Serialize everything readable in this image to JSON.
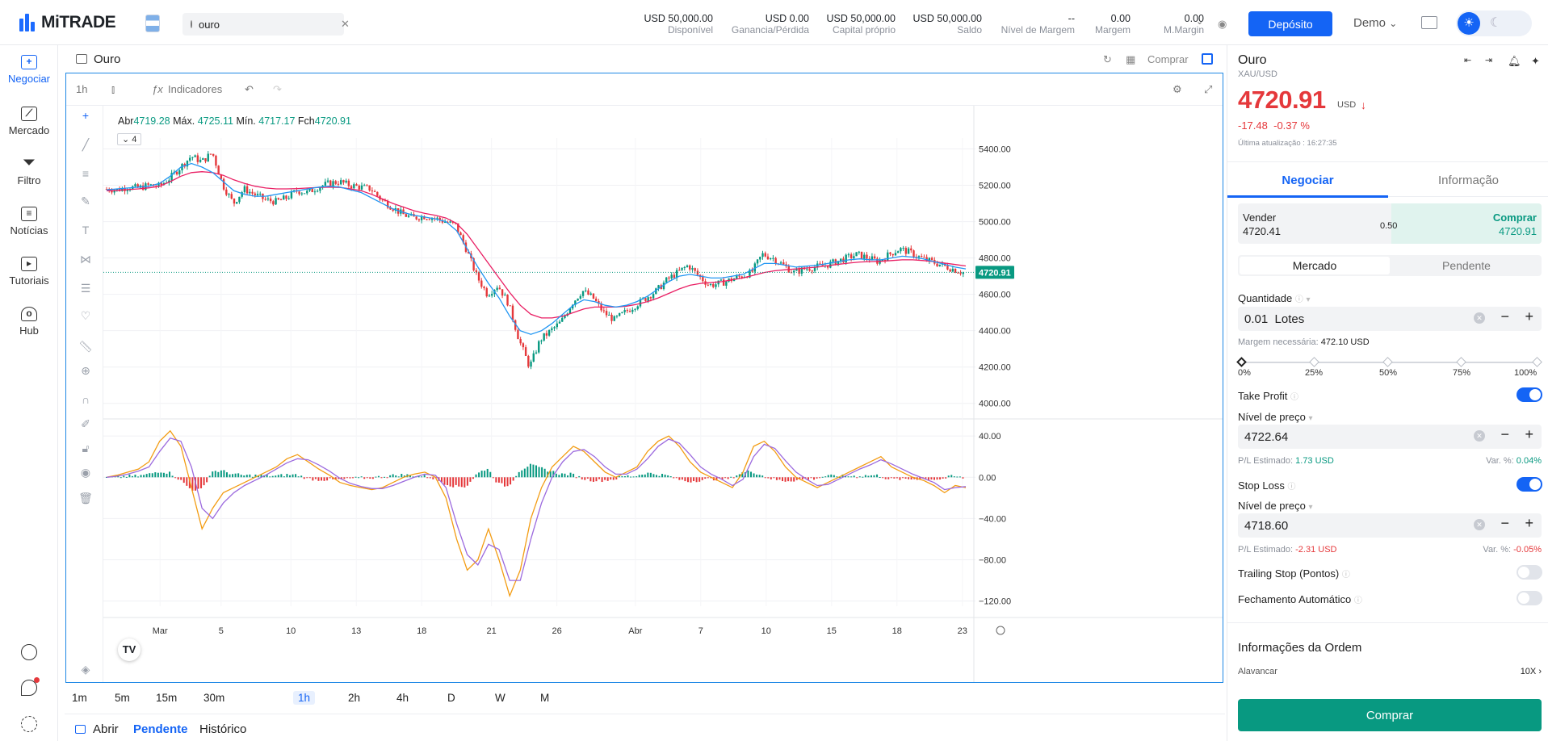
{
  "app": {
    "logo": "MiTRADE",
    "search_value": "ouro"
  },
  "account": [
    {
      "value": "USD 50,000.00",
      "label": "Disponível"
    },
    {
      "value": "USD 0.00",
      "label": "Ganancia/Pérdida"
    },
    {
      "value": "USD 50,000.00",
      "label": "Capital próprio"
    },
    {
      "value": "USD 50,000.00",
      "label": "Saldo"
    },
    {
      "value": "--",
      "label": "Nível de Margem"
    },
    {
      "value": "0.00",
      "label": "Margem"
    },
    {
      "value": "0.00",
      "label": "M.Margin"
    }
  ],
  "header": {
    "deposit": "Depósito",
    "mode": "Demo"
  },
  "sidebar": {
    "items": [
      {
        "label": "Negociar",
        "icon": "plus-square-icon"
      },
      {
        "label": "Mercado",
        "icon": "chart-line-icon"
      },
      {
        "label": "Filtro",
        "icon": "filter-icon"
      },
      {
        "label": "Notícias",
        "icon": "news-icon"
      },
      {
        "label": "Tutoriais",
        "icon": "play-icon"
      },
      {
        "label": "Hub",
        "icon": "user-icon"
      }
    ]
  },
  "chart_panel": {
    "title": "Ouro",
    "buy_link": "Comprar",
    "interval": "1h",
    "indicators": "Indicadores",
    "ohlc": {
      "open_label": "Abr",
      "open": "4719.28",
      "high_label": "Máx.",
      "high": "4725.11",
      "low_label": "Mín.",
      "low": "4717.17",
      "close_label": "Fch",
      "close": "4720.91"
    },
    "collapse_count": "4",
    "timeframes": [
      "1m",
      "5m",
      "15m",
      "30m",
      "1h",
      "2h",
      "4h",
      "D",
      "W",
      "M"
    ],
    "selected_timeframe": "1h"
  },
  "orders_tabs": {
    "open": "Abrir",
    "pending": "Pendente",
    "history": "Histórico"
  },
  "chart_data": {
    "type": "candlestick",
    "y_ticks": [
      "5400.00",
      "5200.00",
      "5000.00",
      "4800.00",
      "4600.00",
      "4400.00",
      "4200.00",
      "4000.00"
    ],
    "ylim": [
      3950,
      5460
    ],
    "x_ticks": [
      "Mar",
      "5",
      "10",
      "13",
      "18",
      "21",
      "26",
      "Abr",
      "7",
      "10",
      "15",
      "18",
      "23"
    ],
    "x_tick_index": [
      0.065,
      0.135,
      0.215,
      0.29,
      0.365,
      0.445,
      0.52,
      0.61,
      0.685,
      0.76,
      0.835,
      0.91,
      0.985
    ],
    "last_price": "4720.91",
    "price_path": [
      5180,
      5175,
      5190,
      5185,
      5200,
      5195,
      5240,
      5300,
      5360,
      5330,
      5380,
      5200,
      5100,
      5180,
      5150,
      5120,
      5110,
      5130,
      5170,
      5160,
      5190,
      5210,
      5220,
      5200,
      5190,
      5180,
      5120,
      5080,
      5040,
      5020,
      5030,
      5020,
      5000,
      4980,
      4850,
      4700,
      4600,
      4650,
      4550,
      4350,
      4200,
      4350,
      4400,
      4450,
      4550,
      4620,
      4580,
      4500,
      4460,
      4500,
      4540,
      4580,
      4620,
      4680,
      4720,
      4760,
      4700,
      4650,
      4660,
      4680,
      4700,
      4720,
      4820,
      4800,
      4760,
      4720,
      4740,
      4750,
      4760,
      4780,
      4800,
      4820,
      4800,
      4780,
      4820,
      4850,
      4830,
      4800,
      4780,
      4760,
      4740,
      4720
    ],
    "ma_fast": [
      5175,
      5180,
      5185,
      5190,
      5195,
      5210,
      5250,
      5300,
      5320,
      5300,
      5270,
      5220,
      5170,
      5150,
      5140,
      5140,
      5150,
      5160,
      5170,
      5180,
      5190,
      5195,
      5190,
      5175,
      5160,
      5130,
      5100,
      5070,
      5050,
      5035,
      5025,
      5015,
      5000,
      4950,
      4850,
      4750,
      4660,
      4580,
      4480,
      4400,
      4380,
      4400,
      4440,
      4490,
      4540,
      4570,
      4560,
      4540,
      4530,
      4540,
      4560,
      4590,
      4630,
      4670,
      4700,
      4710,
      4700,
      4690,
      4690,
      4700,
      4710,
      4740,
      4770,
      4770,
      4760,
      4750,
      4755,
      4760,
      4770,
      4780,
      4790,
      4795,
      4790,
      4790,
      4800,
      4810,
      4805,
      4795,
      4780,
      4765,
      4750,
      4740
    ],
    "ma_slow": [
      5170,
      5172,
      5176,
      5180,
      5186,
      5195,
      5220,
      5250,
      5270,
      5275,
      5270,
      5255,
      5230,
      5210,
      5195,
      5185,
      5180,
      5180,
      5182,
      5185,
      5188,
      5190,
      5188,
      5180,
      5170,
      5150,
      5125,
      5100,
      5080,
      5060,
      5045,
      5035,
      5020,
      4990,
      4930,
      4850,
      4770,
      4690,
      4610,
      4540,
      4490,
      4470,
      4470,
      4480,
      4500,
      4520,
      4530,
      4530,
      4530,
      4535,
      4545,
      4560,
      4580,
      4605,
      4630,
      4650,
      4660,
      4665,
      4670,
      4680,
      4690,
      4705,
      4720,
      4730,
      4735,
      4740,
      4745,
      4750,
      4758,
      4765,
      4772,
      4778,
      4780,
      4782,
      4786,
      4790,
      4790,
      4786,
      4780,
      4772,
      4764,
      4756
    ],
    "osc_ticks": [
      "40.00",
      "0.00",
      "−40.00",
      "−80.00",
      "−120.00"
    ],
    "osc_lim": [
      -125,
      55
    ],
    "osc_macd": [
      0,
      2,
      5,
      8,
      15,
      35,
      45,
      30,
      -10,
      -50,
      -30,
      -15,
      -10,
      -5,
      0,
      5,
      10,
      18,
      22,
      15,
      8,
      2,
      -5,
      -8,
      -10,
      -12,
      -10,
      -5,
      0,
      3,
      5,
      0,
      -20,
      -60,
      -90,
      -80,
      -50,
      -80,
      -115,
      -90,
      -40,
      -10,
      10,
      20,
      30,
      25,
      15,
      5,
      0,
      5,
      10,
      25,
      35,
      40,
      30,
      15,
      5,
      0,
      -5,
      -10,
      5,
      30,
      35,
      25,
      10,
      0,
      -5,
      -10,
      -5,
      0,
      5,
      10,
      15,
      20,
      10,
      5,
      0,
      -3,
      -8,
      -15,
      -8,
      -10
    ],
    "osc_signal": [
      0,
      1,
      3,
      6,
      10,
      25,
      38,
      35,
      10,
      -30,
      -40,
      -25,
      -15,
      -8,
      -3,
      2,
      8,
      14,
      18,
      17,
      12,
      6,
      -1,
      -6,
      -9,
      -11,
      -11,
      -8,
      -4,
      0,
      3,
      2,
      -10,
      -45,
      -75,
      -85,
      -65,
      -70,
      -100,
      -100,
      -60,
      -25,
      0,
      15,
      25,
      27,
      20,
      10,
      3,
      3,
      8,
      18,
      30,
      37,
      33,
      22,
      10,
      3,
      -2,
      -8,
      -2,
      20,
      32,
      28,
      16,
      5,
      -2,
      -8,
      -7,
      -2,
      3,
      8,
      12,
      17,
      13,
      8,
      3,
      -1,
      -5,
      -12,
      -10,
      -9
    ]
  },
  "trade": {
    "name": "Ouro",
    "symbol": "XAU/USD",
    "price": "4720.91",
    "currency": "USD",
    "change": "-17.48",
    "change_pct": "-0.37 %",
    "updated": "Última atualização : 16:27:35",
    "tabs": [
      "Negociar",
      "Informação"
    ],
    "sell_label": "Vender",
    "sell_price": "4720.41",
    "spread": "0.50",
    "buy_label": "Comprar",
    "buy_price": "4720.91",
    "order_types": [
      "Mercado",
      "Pendente"
    ],
    "quantity_label": "Quantidade",
    "quantity_value": "0.01  Lotes",
    "margin_label": "Margem necessária:",
    "margin_value": "472.10 USD",
    "slider_marks": [
      "0%",
      "25%",
      "50%",
      "75%",
      "100%"
    ],
    "slider_level": 0,
    "tp_label": "Take Profit",
    "tp_on": true,
    "price_level_label": "Nível de preço",
    "tp_value": "4722.64",
    "pl_label": "P/L Estimado:",
    "tp_pl": "1.73 USD",
    "var_label": "Var. %:",
    "tp_var": "0.04%",
    "sl_label": "Stop Loss",
    "sl_on": true,
    "sl_value": "4718.60",
    "sl_pl": "-2.31 USD",
    "sl_var": "-0.05%",
    "trailing_label": "Trailing Stop (Pontos)",
    "auto_close_label": "Fechamento Automático",
    "info_title": "Informações da Ordem",
    "leverage_label": "Alavancar",
    "leverage_value": "10X",
    "buy_button": "Comprar"
  },
  "colors": {
    "accent": "#1464f5",
    "down": "#e5383b",
    "up": "#089981",
    "ma_fast": "#2196f3",
    "ma_slow": "#e91e63"
  }
}
